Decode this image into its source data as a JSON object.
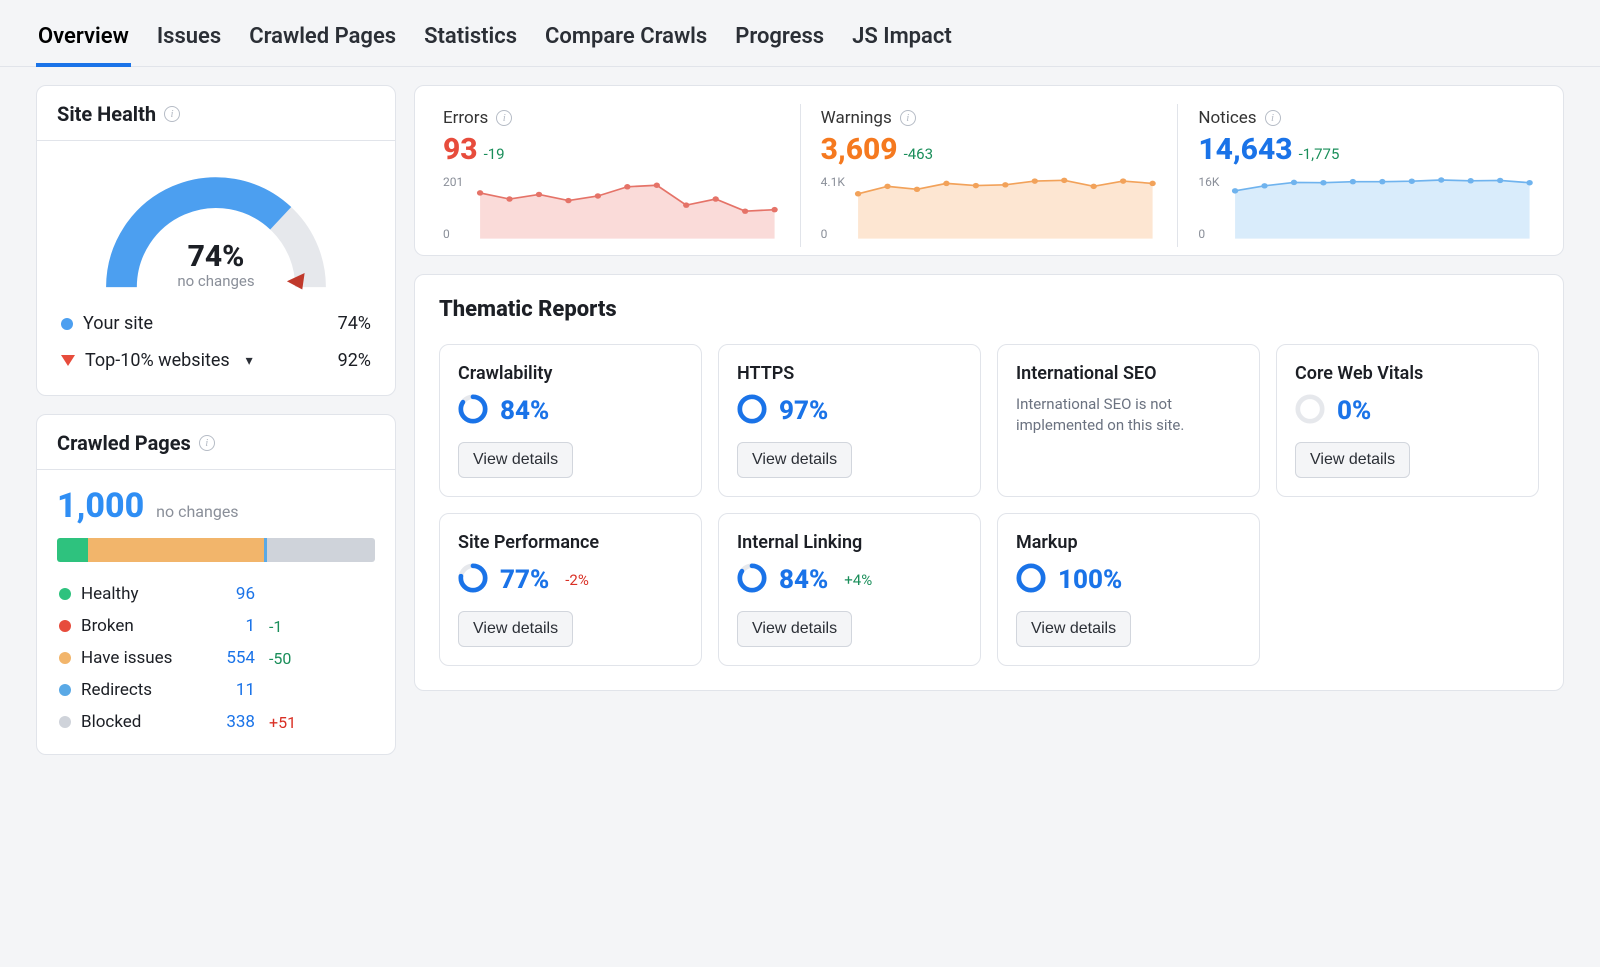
{
  "tabs": [
    "Overview",
    "Issues",
    "Crawled Pages",
    "Statistics",
    "Compare Crawls",
    "Progress",
    "JS Impact"
  ],
  "active_tab": 0,
  "site_health": {
    "title": "Site Health",
    "value": "74%",
    "sub": "no changes",
    "your_site_label": "Your site",
    "your_site_val": "74%",
    "top10_label": "Top-10% websites",
    "top10_val": "92%"
  },
  "crawled_pages": {
    "title": "Crawled Pages",
    "total": "1,000",
    "nochg": "no changes",
    "rows": [
      {
        "label": "Healthy",
        "val": "96",
        "delta": "",
        "color": "#2ec27e"
      },
      {
        "label": "Broken",
        "val": "1",
        "delta": "-1",
        "deltaClass": "delta-green",
        "color": "#e74c3c"
      },
      {
        "label": "Have issues",
        "val": "554",
        "delta": "-50",
        "deltaClass": "delta-green",
        "color": "#f2b56b"
      },
      {
        "label": "Redirects",
        "val": "11",
        "delta": "",
        "color": "#5aa9e6"
      },
      {
        "label": "Blocked",
        "val": "338",
        "delta": "+51",
        "deltaClass": "delta-red",
        "color": "#cfd3da"
      }
    ]
  },
  "metrics": [
    {
      "label": "Errors",
      "value": "93",
      "delta": "-19",
      "color": "#e74c3c",
      "ymax": "201",
      "ymin": "0",
      "fill": "#fadbd9",
      "stroke": "#e57368"
    },
    {
      "label": "Warnings",
      "value": "3,609",
      "delta": "-463",
      "color": "#f5791f",
      "ymax": "4.1K",
      "ymin": "0",
      "fill": "#fde6d2",
      "stroke": "#f2a25a"
    },
    {
      "label": "Notices",
      "value": "14,643",
      "delta": "-1,775",
      "color": "#1a73e8",
      "ymax": "16K",
      "ymin": "0",
      "fill": "#d9ecfb",
      "stroke": "#6fb3ee"
    }
  ],
  "thematic": {
    "title": "Thematic Reports",
    "view": "View details",
    "cards": [
      {
        "title": "Crawlability",
        "pct": "84%",
        "delta": "",
        "ring": 84,
        "ringColor": "#1a73e8"
      },
      {
        "title": "HTTPS",
        "pct": "97%",
        "delta": "",
        "ring": 97,
        "ringColor": "#1a73e8"
      },
      {
        "title": "International SEO",
        "note": "International SEO is not implemented on this site."
      },
      {
        "title": "Core Web Vitals",
        "pct": "0%",
        "delta": "",
        "ring": 0,
        "ringColor": "#cfd3da"
      },
      {
        "title": "Site Performance",
        "pct": "77%",
        "delta": "-2%",
        "deltaClass": "delta-red",
        "ring": 77,
        "ringColor": "#1a73e8"
      },
      {
        "title": "Internal Linking",
        "pct": "84%",
        "delta": "+4%",
        "deltaClass": "delta-green",
        "ring": 84,
        "ringColor": "#1a73e8"
      },
      {
        "title": "Markup",
        "pct": "100%",
        "delta": "",
        "ring": 100,
        "ringColor": "#1a73e8"
      }
    ]
  },
  "chart_data": {
    "gauge": {
      "type": "gauge",
      "value": 74,
      "max": 100,
      "benchmark": 92
    },
    "crawled_bar": {
      "type": "bar",
      "categories": [
        "Healthy",
        "Broken",
        "Have issues",
        "Redirects",
        "Blocked"
      ],
      "values": [
        96,
        1,
        554,
        11,
        338
      ],
      "total": 1000
    },
    "sparks": [
      {
        "type": "area",
        "name": "Errors",
        "ylim": [
          0,
          201
        ],
        "x": [
          1,
          2,
          3,
          4,
          5,
          6,
          7,
          8,
          9,
          10,
          11
        ],
        "values": [
          150,
          130,
          145,
          125,
          140,
          170,
          175,
          110,
          130,
          90,
          95
        ]
      },
      {
        "type": "area",
        "name": "Warnings",
        "ylim": [
          0,
          4100
        ],
        "x": [
          1,
          2,
          3,
          4,
          5,
          6,
          7,
          8,
          9,
          10,
          11
        ],
        "values": [
          3000,
          3500,
          3300,
          3700,
          3550,
          3600,
          3850,
          3900,
          3500,
          3850,
          3700
        ]
      },
      {
        "type": "area",
        "name": "Notices",
        "ylim": [
          0,
          16000
        ],
        "x": [
          1,
          2,
          3,
          4,
          5,
          6,
          7,
          8,
          9,
          10,
          11
        ],
        "values": [
          12500,
          13800,
          14700,
          14600,
          14900,
          14900,
          15000,
          15300,
          15100,
          15200,
          14600
        ]
      }
    ],
    "rings": [
      {
        "name": "Crawlability",
        "value": 84
      },
      {
        "name": "HTTPS",
        "value": 97
      },
      {
        "name": "Core Web Vitals",
        "value": 0
      },
      {
        "name": "Site Performance",
        "value": 77
      },
      {
        "name": "Internal Linking",
        "value": 84
      },
      {
        "name": "Markup",
        "value": 100
      }
    ]
  }
}
